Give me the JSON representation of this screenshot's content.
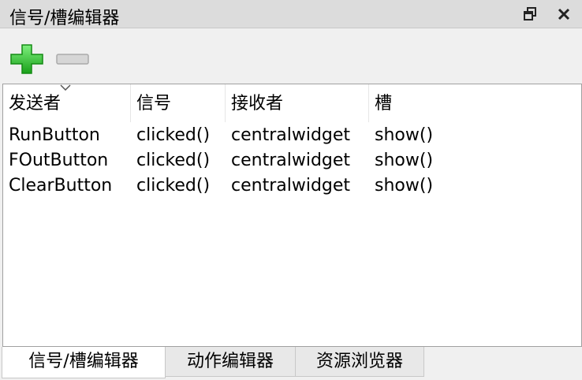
{
  "window": {
    "title": "信号/槽编辑器"
  },
  "icons": {
    "float": "float-window-icon",
    "close": "close-icon",
    "add": "add-icon",
    "remove": "remove-icon",
    "sort": "sort-indicator-icon"
  },
  "colors": {
    "add_green": "#3cc13c",
    "remove_gray": "#c8c8c8"
  },
  "table": {
    "headers": [
      "发送者",
      "信号",
      "接收者",
      "槽"
    ],
    "rows": [
      [
        "RunButton",
        "clicked()",
        "centralwidget",
        "show()"
      ],
      [
        "FOutButton",
        "clicked()",
        "centralwidget",
        "show()"
      ],
      [
        "ClearButton",
        "clicked()",
        "centralwidget",
        "show()"
      ]
    ]
  },
  "tabs": [
    {
      "label": "信号/槽编辑器",
      "active": true
    },
    {
      "label": "动作编辑器",
      "active": false
    },
    {
      "label": "资源浏览器",
      "active": false
    }
  ]
}
